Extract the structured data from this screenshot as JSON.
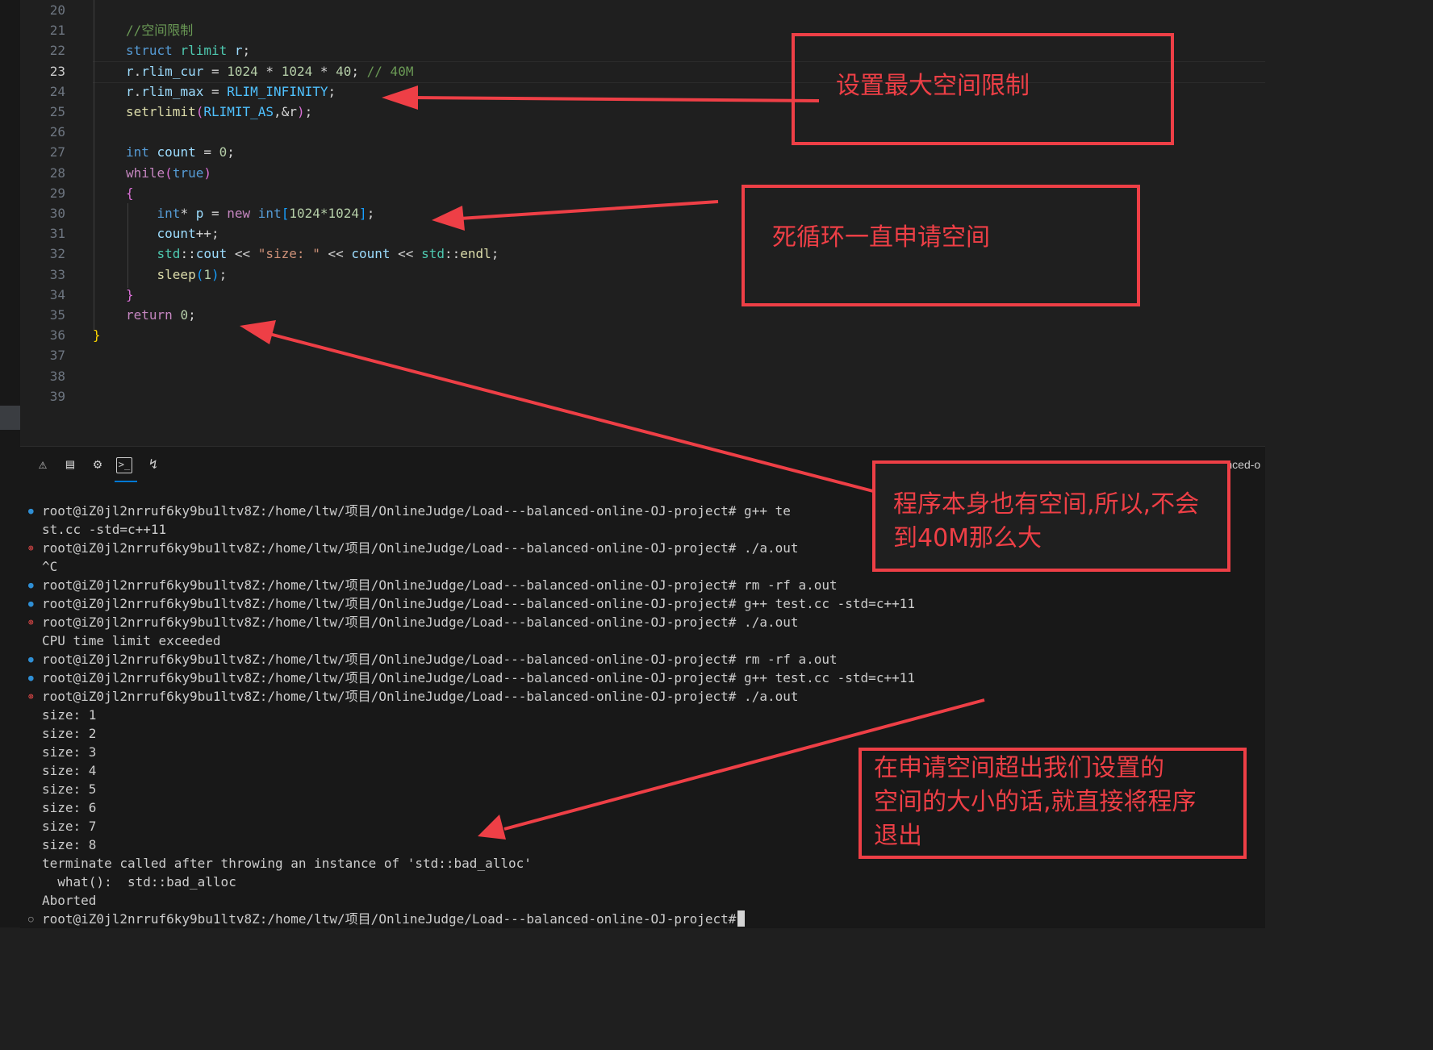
{
  "editor": {
    "active_line": 23,
    "line_numbers": [
      "20",
      "21",
      "22",
      "23",
      "24",
      "25",
      "26",
      "27",
      "28",
      "29",
      "30",
      "31",
      "32",
      "33",
      "34",
      "35",
      "36",
      "37",
      "38",
      "39"
    ],
    "code": {
      "comment_space": "//空间限制",
      "struct_kw": "struct",
      "rlimit_type": "rlimit",
      "var_r": "r",
      "r_cur": "r",
      "rlim_cur": "rlim_cur",
      "num_1024a": "1024",
      "num_1024b": "1024",
      "num_40": "40",
      "comment_40m": "// 40M",
      "r_max": "r",
      "rlim_max": "rlim_max",
      "rlim_infinity": "RLIM_INFINITY",
      "setrlimit": "setrlimit",
      "rlimit_as": "RLIMIT_AS",
      "amp_r": "&r",
      "int_kw": "int",
      "count_var": "count",
      "zero": "0",
      "while_kw": "while",
      "true_kw": "true",
      "int_ptr": "int",
      "p_var": "p",
      "new_kw": "new",
      "int_arr": "int",
      "arr_size": "1024*1024",
      "count_inc": "count",
      "std_a": "std",
      "cout": "cout",
      "size_str": "\"size: \"",
      "count_out": "count",
      "std_b": "std",
      "endl": "endl",
      "sleep": "sleep",
      "one": "1",
      "return_kw": "return",
      "ret_zero": "0"
    }
  },
  "panel": {
    "tab_icons": [
      "warning-icon",
      "output-icon",
      "debug-console-icon",
      "terminal-icon",
      "ports-icon"
    ],
    "terminal_title": "bash - Load---balanced-o",
    "prompt": "root@iZ0jl2nrruf6ky9bu1ltv8Z:/home/ltw/项目/OnlineJudge/Load---balanced-online-OJ-project#",
    "lines": [
      {
        "status": "ok",
        "text": "root@iZ0jl2nrruf6ky9bu1ltv8Z:/home/ltw/项目/OnlineJudge/Load---balanced-online-OJ-project# g++ te"
      },
      {
        "status": "none",
        "text": "st.cc -std=c++11"
      },
      {
        "status": "err",
        "text": "root@iZ0jl2nrruf6ky9bu1ltv8Z:/home/ltw/项目/OnlineJudge/Load---balanced-online-OJ-project# ./a.out"
      },
      {
        "status": "none",
        "text": "^C"
      },
      {
        "status": "ok",
        "text": "root@iZ0jl2nrruf6ky9bu1ltv8Z:/home/ltw/项目/OnlineJudge/Load---balanced-online-OJ-project# rm -rf a.out"
      },
      {
        "status": "ok",
        "text": "root@iZ0jl2nrruf6ky9bu1ltv8Z:/home/ltw/项目/OnlineJudge/Load---balanced-online-OJ-project# g++ test.cc -std=c++11"
      },
      {
        "status": "err",
        "text": "root@iZ0jl2nrruf6ky9bu1ltv8Z:/home/ltw/项目/OnlineJudge/Load---balanced-online-OJ-project# ./a.out"
      },
      {
        "status": "none",
        "text": "CPU time limit exceeded"
      },
      {
        "status": "ok",
        "text": "root@iZ0jl2nrruf6ky9bu1ltv8Z:/home/ltw/项目/OnlineJudge/Load---balanced-online-OJ-project# rm -rf a.out"
      },
      {
        "status": "ok",
        "text": "root@iZ0jl2nrruf6ky9bu1ltv8Z:/home/ltw/项目/OnlineJudge/Load---balanced-online-OJ-project# g++ test.cc -std=c++11"
      },
      {
        "status": "err",
        "text": "root@iZ0jl2nrruf6ky9bu1ltv8Z:/home/ltw/项目/OnlineJudge/Load---balanced-online-OJ-project# ./a.out"
      },
      {
        "status": "none",
        "text": "size: 1"
      },
      {
        "status": "none",
        "text": "size: 2"
      },
      {
        "status": "none",
        "text": "size: 3"
      },
      {
        "status": "none",
        "text": "size: 4"
      },
      {
        "status": "none",
        "text": "size: 5"
      },
      {
        "status": "none",
        "text": "size: 6"
      },
      {
        "status": "none",
        "text": "size: 7"
      },
      {
        "status": "none",
        "text": "size: 8"
      },
      {
        "status": "none",
        "text": "terminate called after throwing an instance of 'std::bad_alloc'"
      },
      {
        "status": "none",
        "text": "  what():  std::bad_alloc"
      },
      {
        "status": "none",
        "text": "Aborted"
      },
      {
        "status": "idle",
        "text": "root@iZ0jl2nrruf6ky9bu1ltv8Z:/home/ltw/项目/OnlineJudge/Load---balanced-online-OJ-project#"
      }
    ]
  },
  "annotations": {
    "box1": "设置最大空间限制",
    "box2": "死循环一直申请空间",
    "box3": [
      "程序本身也有空间,所以,不会",
      "到40M那么大"
    ],
    "box4": [
      "在申请空间超出我们设置的",
      "空间的大小的话,就直接将程序",
      "退出"
    ]
  },
  "colors": {
    "annotation_red": "#ee3f46",
    "editor_bg": "#1f1f1f",
    "panel_bg": "#181818",
    "accent_blue": "#0078d4"
  }
}
